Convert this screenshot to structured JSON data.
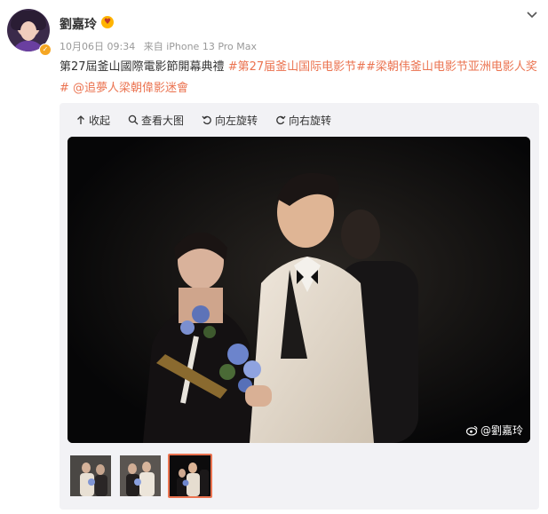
{
  "post": {
    "username": "劉嘉玲",
    "user_badge_icon": "heart-eyes-emoji-icon",
    "date": "10月06日 09:34",
    "source": "来自 iPhone 13 Pro Max",
    "text_plain": "第27屆釜山國際電影節開幕典禮 ",
    "tag1": "#第27届釜山国际电影节#",
    "tag2": "#梁朝伟釜山电影节亚洲电影人奖#",
    "mention": "@追夢人梁朝偉影迷會"
  },
  "media": {
    "toolbar": {
      "collapse": "收起",
      "view_large": "查看大图",
      "rotate_left": "向左旋转",
      "rotate_right": "向右旋转"
    },
    "watermark": "@劉嘉玲",
    "thumbnails": [
      {
        "active": false
      },
      {
        "active": false
      },
      {
        "active": true
      }
    ]
  },
  "colors": {
    "accent": "#eb7350",
    "muted": "#999999",
    "panel_bg": "#f2f2f5"
  }
}
